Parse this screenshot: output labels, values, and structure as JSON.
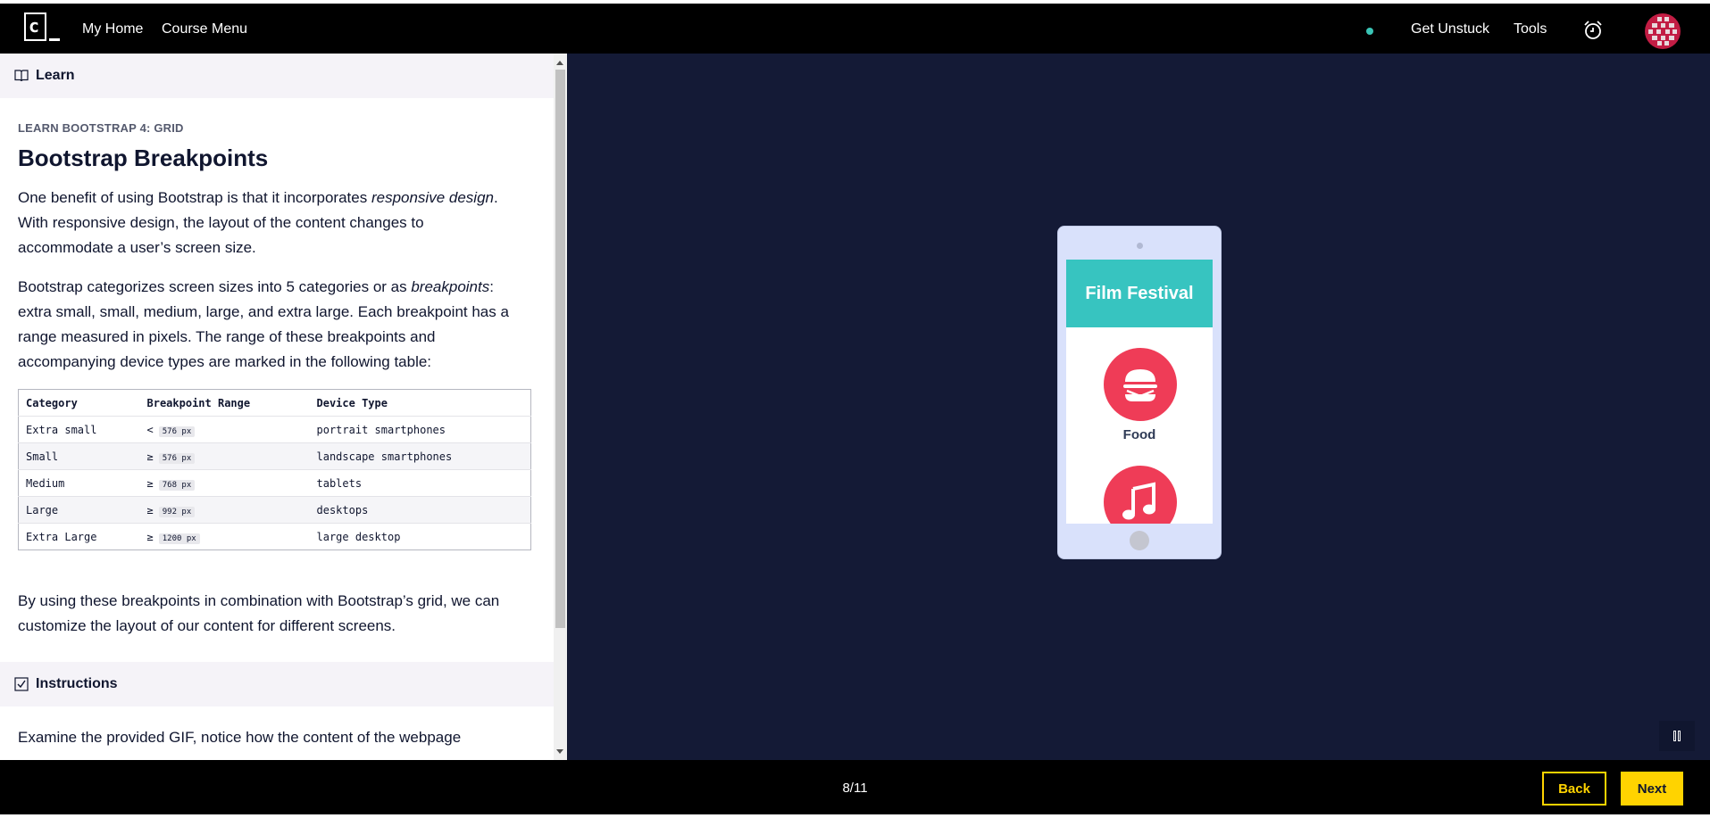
{
  "topnav": {
    "logo_text": "c",
    "links": [
      "My Home",
      "Course Menu"
    ],
    "right_links": [
      "Get Unstuck",
      "Tools"
    ],
    "icons": [
      "status-dot",
      "alarm-clock-icon",
      "avatar"
    ]
  },
  "learn": {
    "header": "Learn",
    "breadcrumb": "LEARN BOOTSTRAP 4: GRID",
    "title": "Bootstrap Breakpoints",
    "p1_before": "One benefit of using Bootstrap is that it incorporates ",
    "p1_em": "responsive design",
    "p1_after": ". With responsive design, the layout of the content changes to accommodate a user’s screen size.",
    "p2_before": "Bootstrap categorizes screen sizes into 5 categories or as ",
    "p2_em": "breakpoints",
    "p2_after": ": extra small, small, medium, large, and extra large. Each breakpoint has a range measured in pixels. The range of these breakpoints and accompanying device types are marked in the following table:",
    "table": {
      "headers": [
        "Category",
        "Breakpoint Range",
        "Device Type"
      ],
      "rows": [
        {
          "category": "Extra small",
          "op": "<",
          "range": "576 px",
          "device": "portrait smartphones"
        },
        {
          "category": "Small",
          "op": "≥",
          "range": "576 px",
          "device": "landscape smartphones"
        },
        {
          "category": "Medium",
          "op": "≥",
          "range": "768 px",
          "device": "tablets"
        },
        {
          "category": "Large",
          "op": "≥",
          "range": "992 px",
          "device": "desktops"
        },
        {
          "category": "Extra Large",
          "op": "≥",
          "range": "1200 px",
          "device": "large desktop"
        }
      ]
    },
    "p3": "By using these breakpoints in combination with Bootstrap’s grid, we can customize the layout of our content for different screens."
  },
  "instructions": {
    "header": "Instructions",
    "text": "Examine the provided GIF, notice how the content of the webpage"
  },
  "preview": {
    "banner": "Film Festival",
    "item_label": "Food"
  },
  "footer": {
    "progress": "8/11",
    "back": "Back",
    "next": "Next"
  },
  "colors": {
    "accent": "#ffd300",
    "preview_bg": "#141a36",
    "banner": "#37c4c0",
    "circle": "#ef3c57"
  }
}
